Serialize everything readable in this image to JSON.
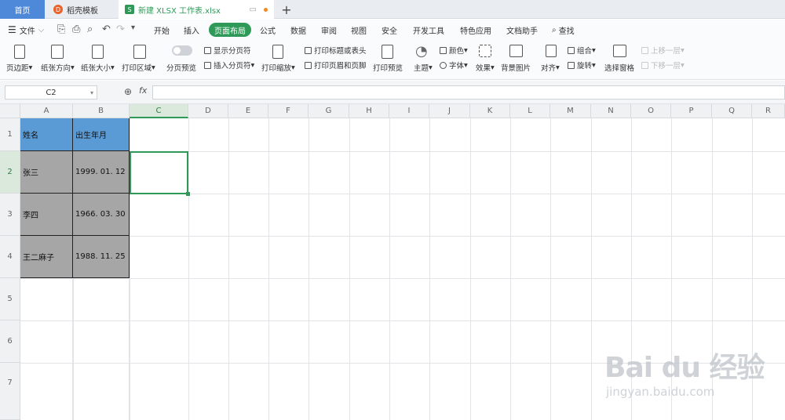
{
  "tabs": {
    "home": "首页",
    "templates": "稻壳模板",
    "file": "新建 XLSX 工作表.xlsx",
    "new": "+"
  },
  "menu": {
    "file": "文件",
    "items": [
      "开始",
      "插入",
      "页面布局",
      "公式",
      "数据",
      "审阅",
      "视图",
      "安全",
      "开发工具",
      "特色应用",
      "文档助手"
    ],
    "active": "页面布局",
    "search": "查找"
  },
  "ribbon": {
    "margins": "页边距",
    "orientation": "纸张方向",
    "size": "纸张大小",
    "print_area": "打印区域",
    "page_preview": "分页预览",
    "show_breaks": "显示分页符",
    "insert_break": "插入分页符",
    "print_scale": "打印缩放",
    "print_titles": "打印标题或表头",
    "print_header_footer": "打印页眉和页脚",
    "print_preview": "打印预览",
    "theme": "主题",
    "colors": "颜色",
    "fonts": "字体",
    "effects": "效果",
    "background": "背景图片",
    "align": "对齐",
    "group": "组合",
    "rotate": "旋转",
    "select_pane": "选择窗格",
    "move_up": "上移一层",
    "move_down": "下移一层"
  },
  "formula": {
    "cell_ref": "C2",
    "fx": "fx",
    "value": ""
  },
  "columns": [
    "A",
    "B",
    "C",
    "D",
    "E",
    "F",
    "G",
    "H",
    "I",
    "J",
    "K",
    "L",
    "M",
    "N",
    "O",
    "P",
    "Q",
    "R"
  ],
  "rows": [
    "1",
    "2",
    "3",
    "4",
    "5",
    "6",
    "7"
  ],
  "table": {
    "header": [
      "姓名",
      "出生年月"
    ],
    "rows": [
      [
        "张三",
        "1999. 01. 12"
      ],
      [
        "李四",
        "1966. 03. 30"
      ],
      [
        "王二麻子",
        "1988. 11. 25"
      ]
    ]
  },
  "colors": {
    "accent": "#2f9a58",
    "header_fill": "#5b9bd5",
    "data_fill": "#a6a6a6"
  },
  "watermark": {
    "main": "Bai du 经验",
    "sub": "jingyan.baidu.com"
  }
}
